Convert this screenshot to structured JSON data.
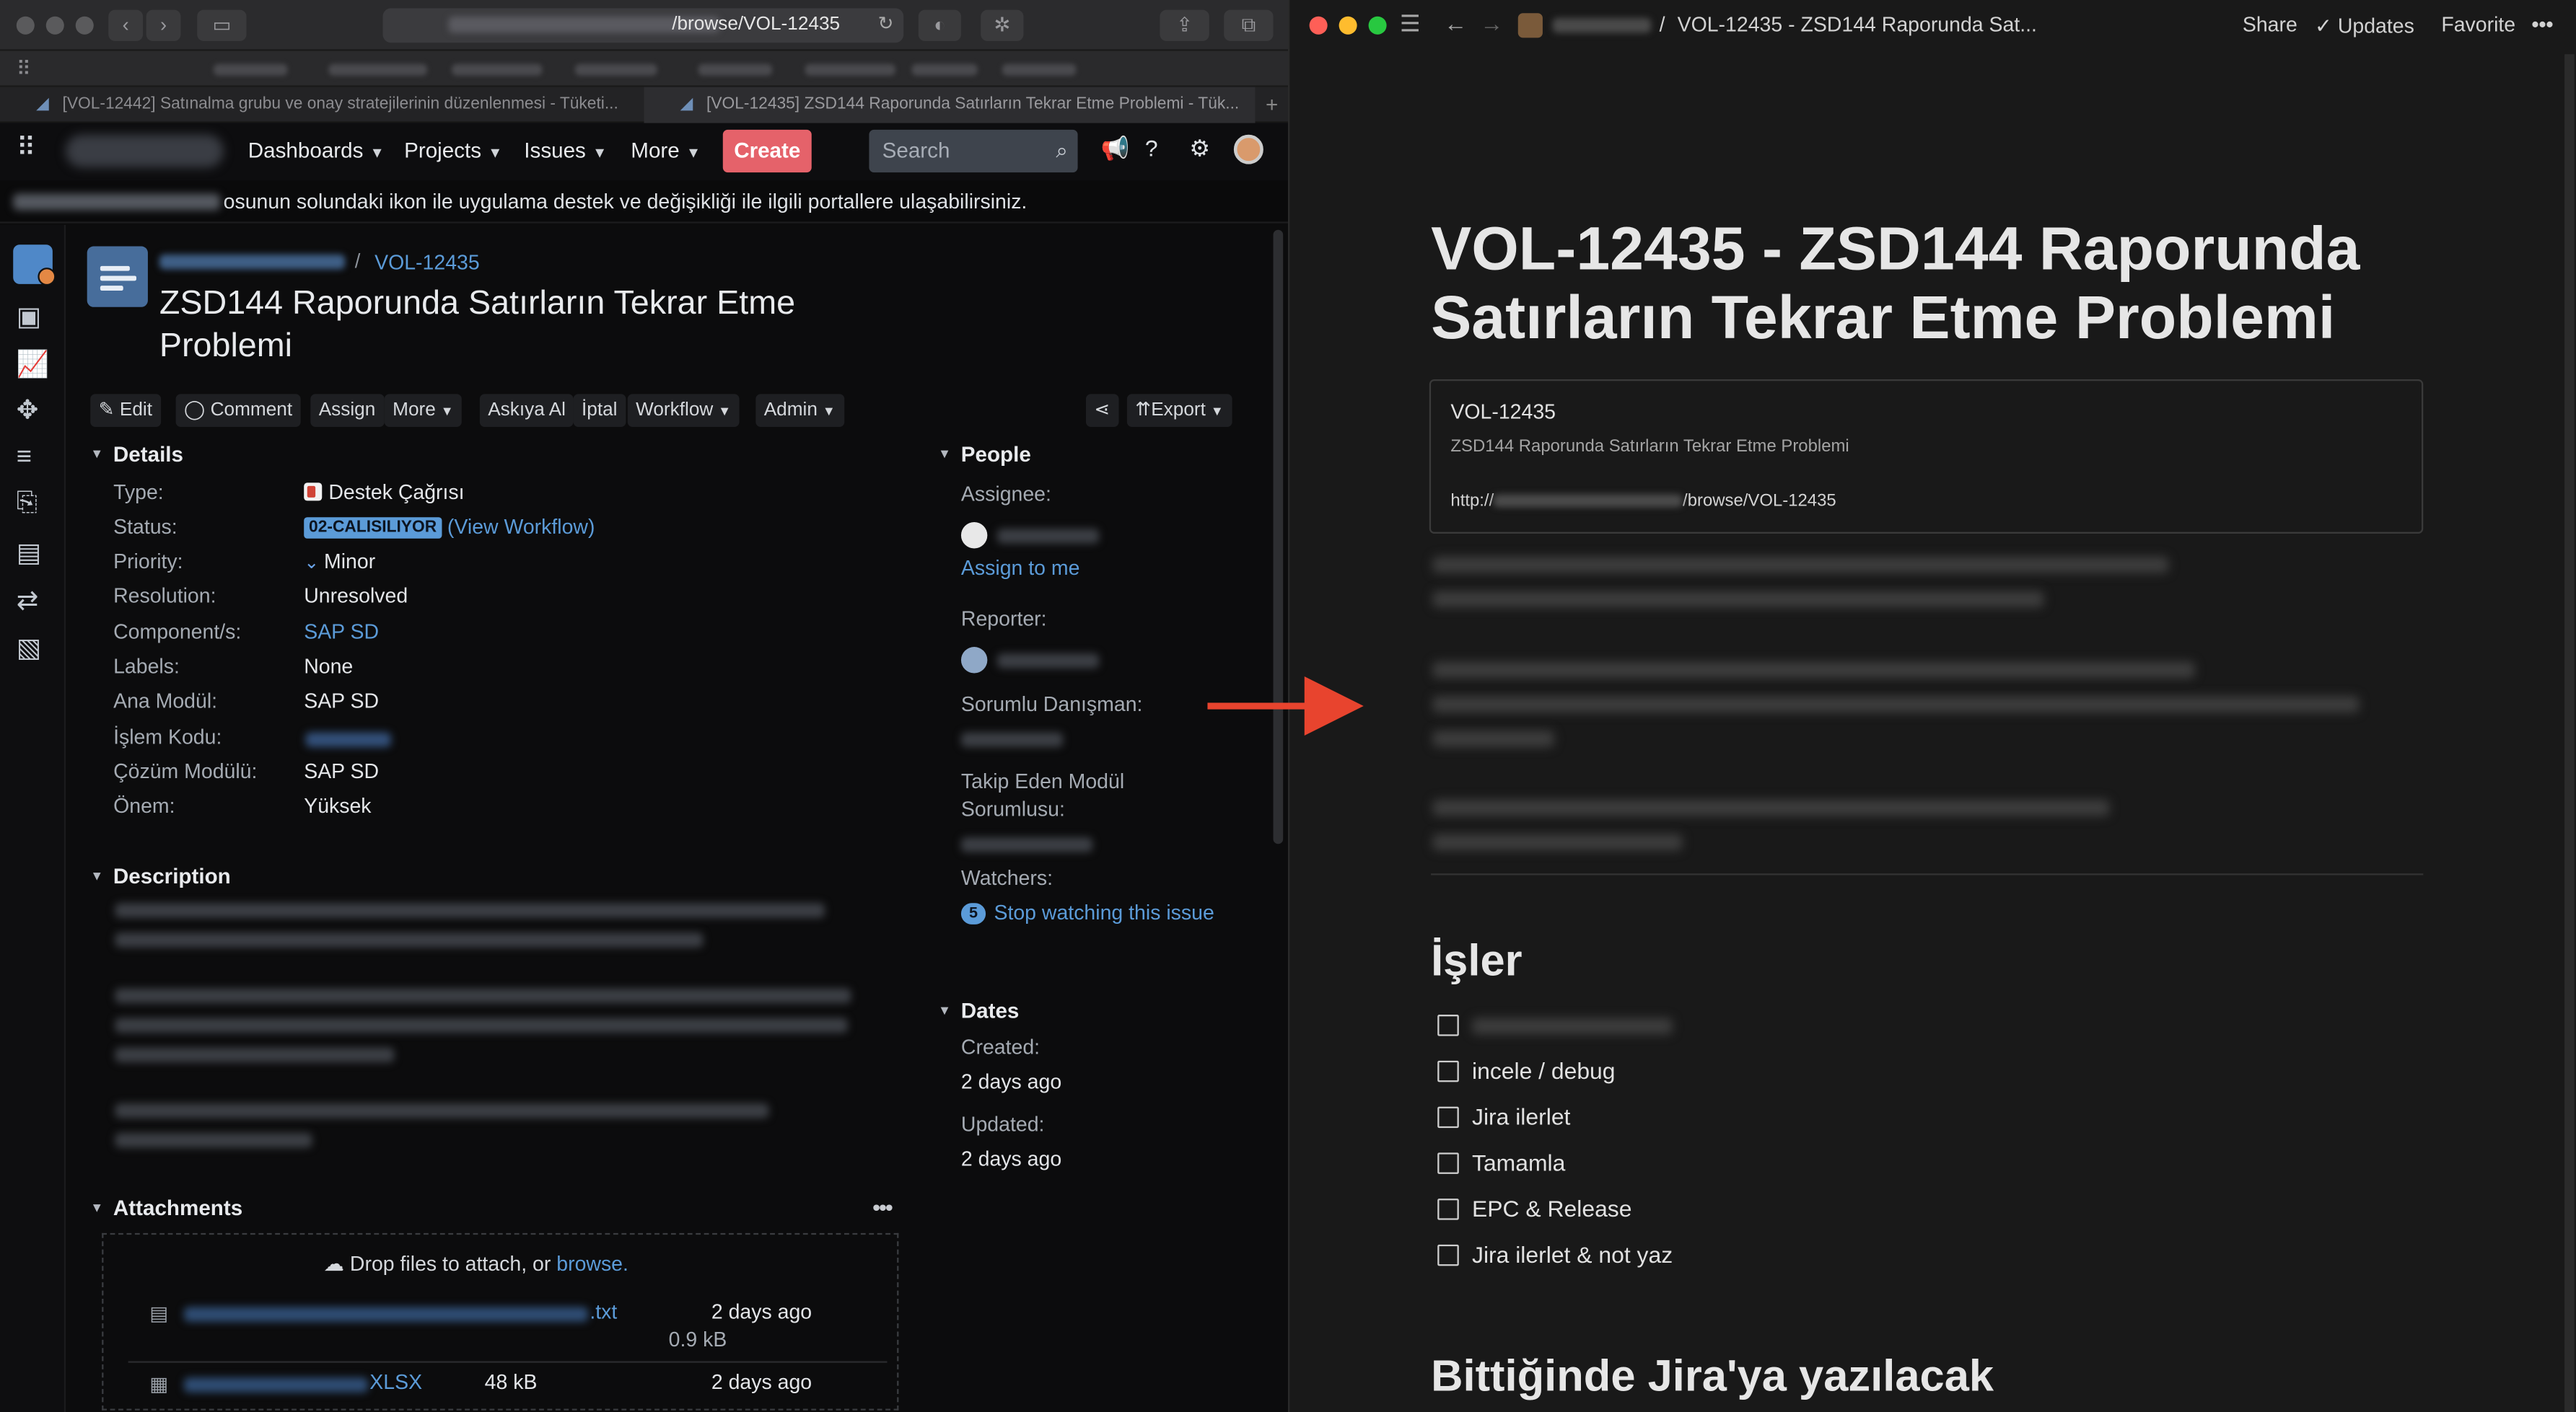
{
  "browser": {
    "url_path": "/browse/VOL-12435",
    "tabs": [
      {
        "label": "[VOL-12442] Satınalma grubu ve onay stratejilerinin düzenlenmesi - Tüketi..."
      },
      {
        "label": "[VOL-12435] ZSD144 Raporunda Satırların Tekrar Etme Problemi - Tük..."
      }
    ]
  },
  "jira": {
    "nav": {
      "dashboards": "Dashboards",
      "projects": "Projects",
      "issues": "Issues",
      "more": "More",
      "create": "Create",
      "search_placeholder": "Search"
    },
    "banner_text": "osunun solundaki ikon ile uygulama destek ve değişikliği ile ilgili portallere ulaşabilirsiniz.",
    "issue": {
      "key": "VOL-12435",
      "title": "ZSD144 Raporunda Satırların Tekrar Etme Problemi"
    },
    "toolbar": {
      "edit": "Edit",
      "comment": "Comment",
      "assign": "Assign",
      "more": "More",
      "askiya_al": "Askıya Al",
      "iptal": "İptal",
      "workflow": "Workflow",
      "admin": "Admin",
      "export": "Export"
    },
    "details": {
      "heading": "Details",
      "type_label": "Type:",
      "type_value": "Destek Çağrısı",
      "status_label": "Status:",
      "status_value": "02-CALISILIYOR",
      "view_workflow": "(View Workflow)",
      "priority_label": "Priority:",
      "priority_value": "Minor",
      "resolution_label": "Resolution:",
      "resolution_value": "Unresolved",
      "component_label": "Component/s:",
      "component_value": "SAP SD",
      "labels_label": "Labels:",
      "labels_value": "None",
      "ana_modul_label": "Ana Modül:",
      "ana_modul_value": "SAP SD",
      "islem_kodu_label": "İşlem Kodu:",
      "cozum_modulu_label": "Çözüm Modülü:",
      "cozum_modulu_value": "SAP SD",
      "onem_label": "Önem:",
      "onem_value": "Yüksek"
    },
    "description_heading": "Description",
    "attachments": {
      "heading": "Attachments",
      "drop_text": "Drop files to attach, or",
      "browse": "browse.",
      "files": [
        {
          "name_suffix": ".txt",
          "date": "2 days ago",
          "size": "0.9 kB"
        },
        {
          "name_suffix": "XLSX",
          "size": "48 kB",
          "date": "2 days ago"
        }
      ]
    },
    "people": {
      "heading": "People",
      "assignee_label": "Assignee:",
      "assign_to_me": "Assign to me",
      "reporter_label": "Reporter:",
      "sorumlu_label": "Sorumlu Danışman:",
      "takip_label_1": "Takip Eden Modül",
      "takip_label_2": "Sorumlusu:",
      "watchers_label": "Watchers:",
      "watchers_count": "5",
      "stop_watching": "Stop watching this issue"
    },
    "dates": {
      "heading": "Dates",
      "created_label": "Created:",
      "created_value": "2 days ago",
      "updated_label": "Updated:",
      "updated_value": "2 days ago"
    }
  },
  "notion": {
    "breadcrumb_sep": "/",
    "breadcrumb_page": "VOL-12435 - ZSD144 Raporunda Sat...",
    "share": "Share",
    "updates": "Updates",
    "favorite": "Favorite",
    "title": "VOL-12435 - ZSD144 Raporunda Satırların Tekrar Etme Problemi",
    "bookmark": {
      "title": "VOL-12435",
      "description": "ZSD144 Raporunda Satırların Tekrar Etme Problemi",
      "url_prefix": "http://",
      "url_suffix": "/browse/VOL-12435"
    },
    "isler_heading": "İşler",
    "todos": [
      "incele / debug",
      "Jira ilerlet",
      "Tamamla",
      "EPC & Release",
      "Jira ilerlet & not yaz"
    ],
    "bittiginde_heading": "Bittiğinde Jira'ya yazılacak"
  },
  "colors": {
    "jira_accent": "#5b9bd8",
    "create_button": "#e5626a",
    "arrow": "#e8442e",
    "notion_bg": "#191919"
  }
}
